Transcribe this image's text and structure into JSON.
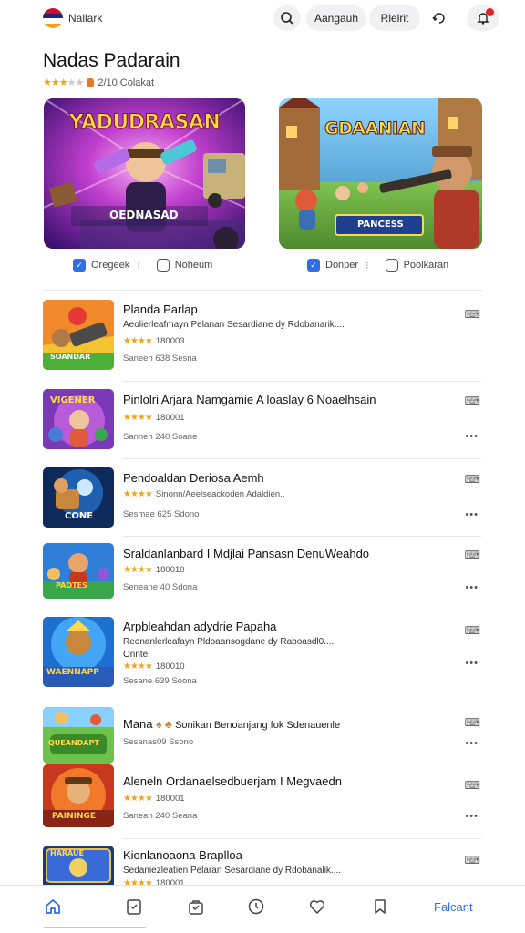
{
  "header": {
    "brand": "Nallark",
    "buttons": [
      {
        "label": "Aangauh"
      },
      {
        "label": "Rlelrit"
      }
    ],
    "icons": [
      "search-icon",
      "refresh-icon",
      "bell-icon"
    ]
  },
  "page": {
    "title": "Nadas Padarain",
    "rating_text": "2/10 Colakat",
    "rating_stars": 3
  },
  "featured": [
    {
      "banner_title": "YADUDRASAN",
      "banner_subtitle": "OEDNASAD",
      "action1": "Oregeek",
      "action1_sep": "⁝",
      "action2": "Noheum",
      "colors": {
        "bg1": "#6b1fb0",
        "bg2": "#e13aa0"
      }
    },
    {
      "banner_title": "GDAANIAN",
      "banner_subtitle": "PANCESS",
      "action1": "Donper",
      "action1_sep": "⁝",
      "action2": "Poolkaran",
      "colors": {
        "bg1": "#3aa0e0",
        "bg2": "#f0a23a"
      }
    }
  ],
  "list": [
    {
      "title": "Planda Parlap",
      "desc": "Aeolierleafmayn Pelanan Sesardiane dy Rdobanarik....",
      "stars": 4,
      "rating_text": "180003",
      "meta": "Saneen 638 Sesna",
      "thumb_label": "SOANDAR",
      "action_icon": "chat-icon"
    },
    {
      "title": "Pinlolri Arjara Namgamie A loaslay 6 Noaelhsain",
      "desc": "",
      "stars": 4,
      "rating_text": "180001",
      "meta": "Sanneh 240 Soane",
      "thumb_label": "VIGENER",
      "action_icon": "chat-icon"
    },
    {
      "title": "Pendoaldan Deriosa Aemh",
      "desc": "Sinonn/Aeelseackoden Adaldien..",
      "stars": 4,
      "rating_text": "",
      "meta": "Sesmae 625 Sdono",
      "thumb_label": "CONE",
      "action_icon": "chat-icon"
    },
    {
      "title": "Sraldanlanbard I Mdjlai Pansasn DenuWeahdo",
      "desc": "",
      "stars": 4,
      "rating_text": "180010",
      "meta": "Seneane 40 Sdona",
      "thumb_label": "PAOTES",
      "action_icon": "chat-icon"
    },
    {
      "title": "Arpbleahdan adydrie Papaha",
      "desc": "Reonanlerleafayn Pldoaansogdane dy Raboasdl0....",
      "desc2": "Onnte",
      "stars": 4,
      "rating_text": "180010",
      "meta": "Sesane 639 Soona",
      "thumb_label": "WAENNAPP",
      "action_icon": "chat-icon"
    },
    {
      "title": "Mana",
      "title_suffix": "Sonikan Benoanjang fok Sdenauenle",
      "desc": "",
      "stars": 0,
      "rating_text": "",
      "meta": "Sesanas09 Ssono",
      "thumb_label": "QUEANDAPT",
      "action_icon": "chat-icon"
    },
    {
      "title": "Aleneln Ordanaelsedbuerjam I Megvaedn",
      "desc": "",
      "stars": 4,
      "rating_text": "180001",
      "meta": "Sanean 240 Seana",
      "thumb_label": "PAININGE",
      "action_icon": "chat-icon"
    },
    {
      "title": "Kionlanoaona Braplloa",
      "desc": "Sedaniezleatien Pelaran Sesardiane dy Rdobanalik....",
      "stars": 4,
      "rating_text": "180001",
      "meta": "",
      "thumb_label": "HARAUE",
      "action_icon": "chat-icon"
    }
  ],
  "bottom_nav": {
    "icons": [
      "home-icon",
      "checklist-icon",
      "bag-icon",
      "clock-icon",
      "heart-icon",
      "bookmark-icon"
    ],
    "label": "Falcant"
  }
}
